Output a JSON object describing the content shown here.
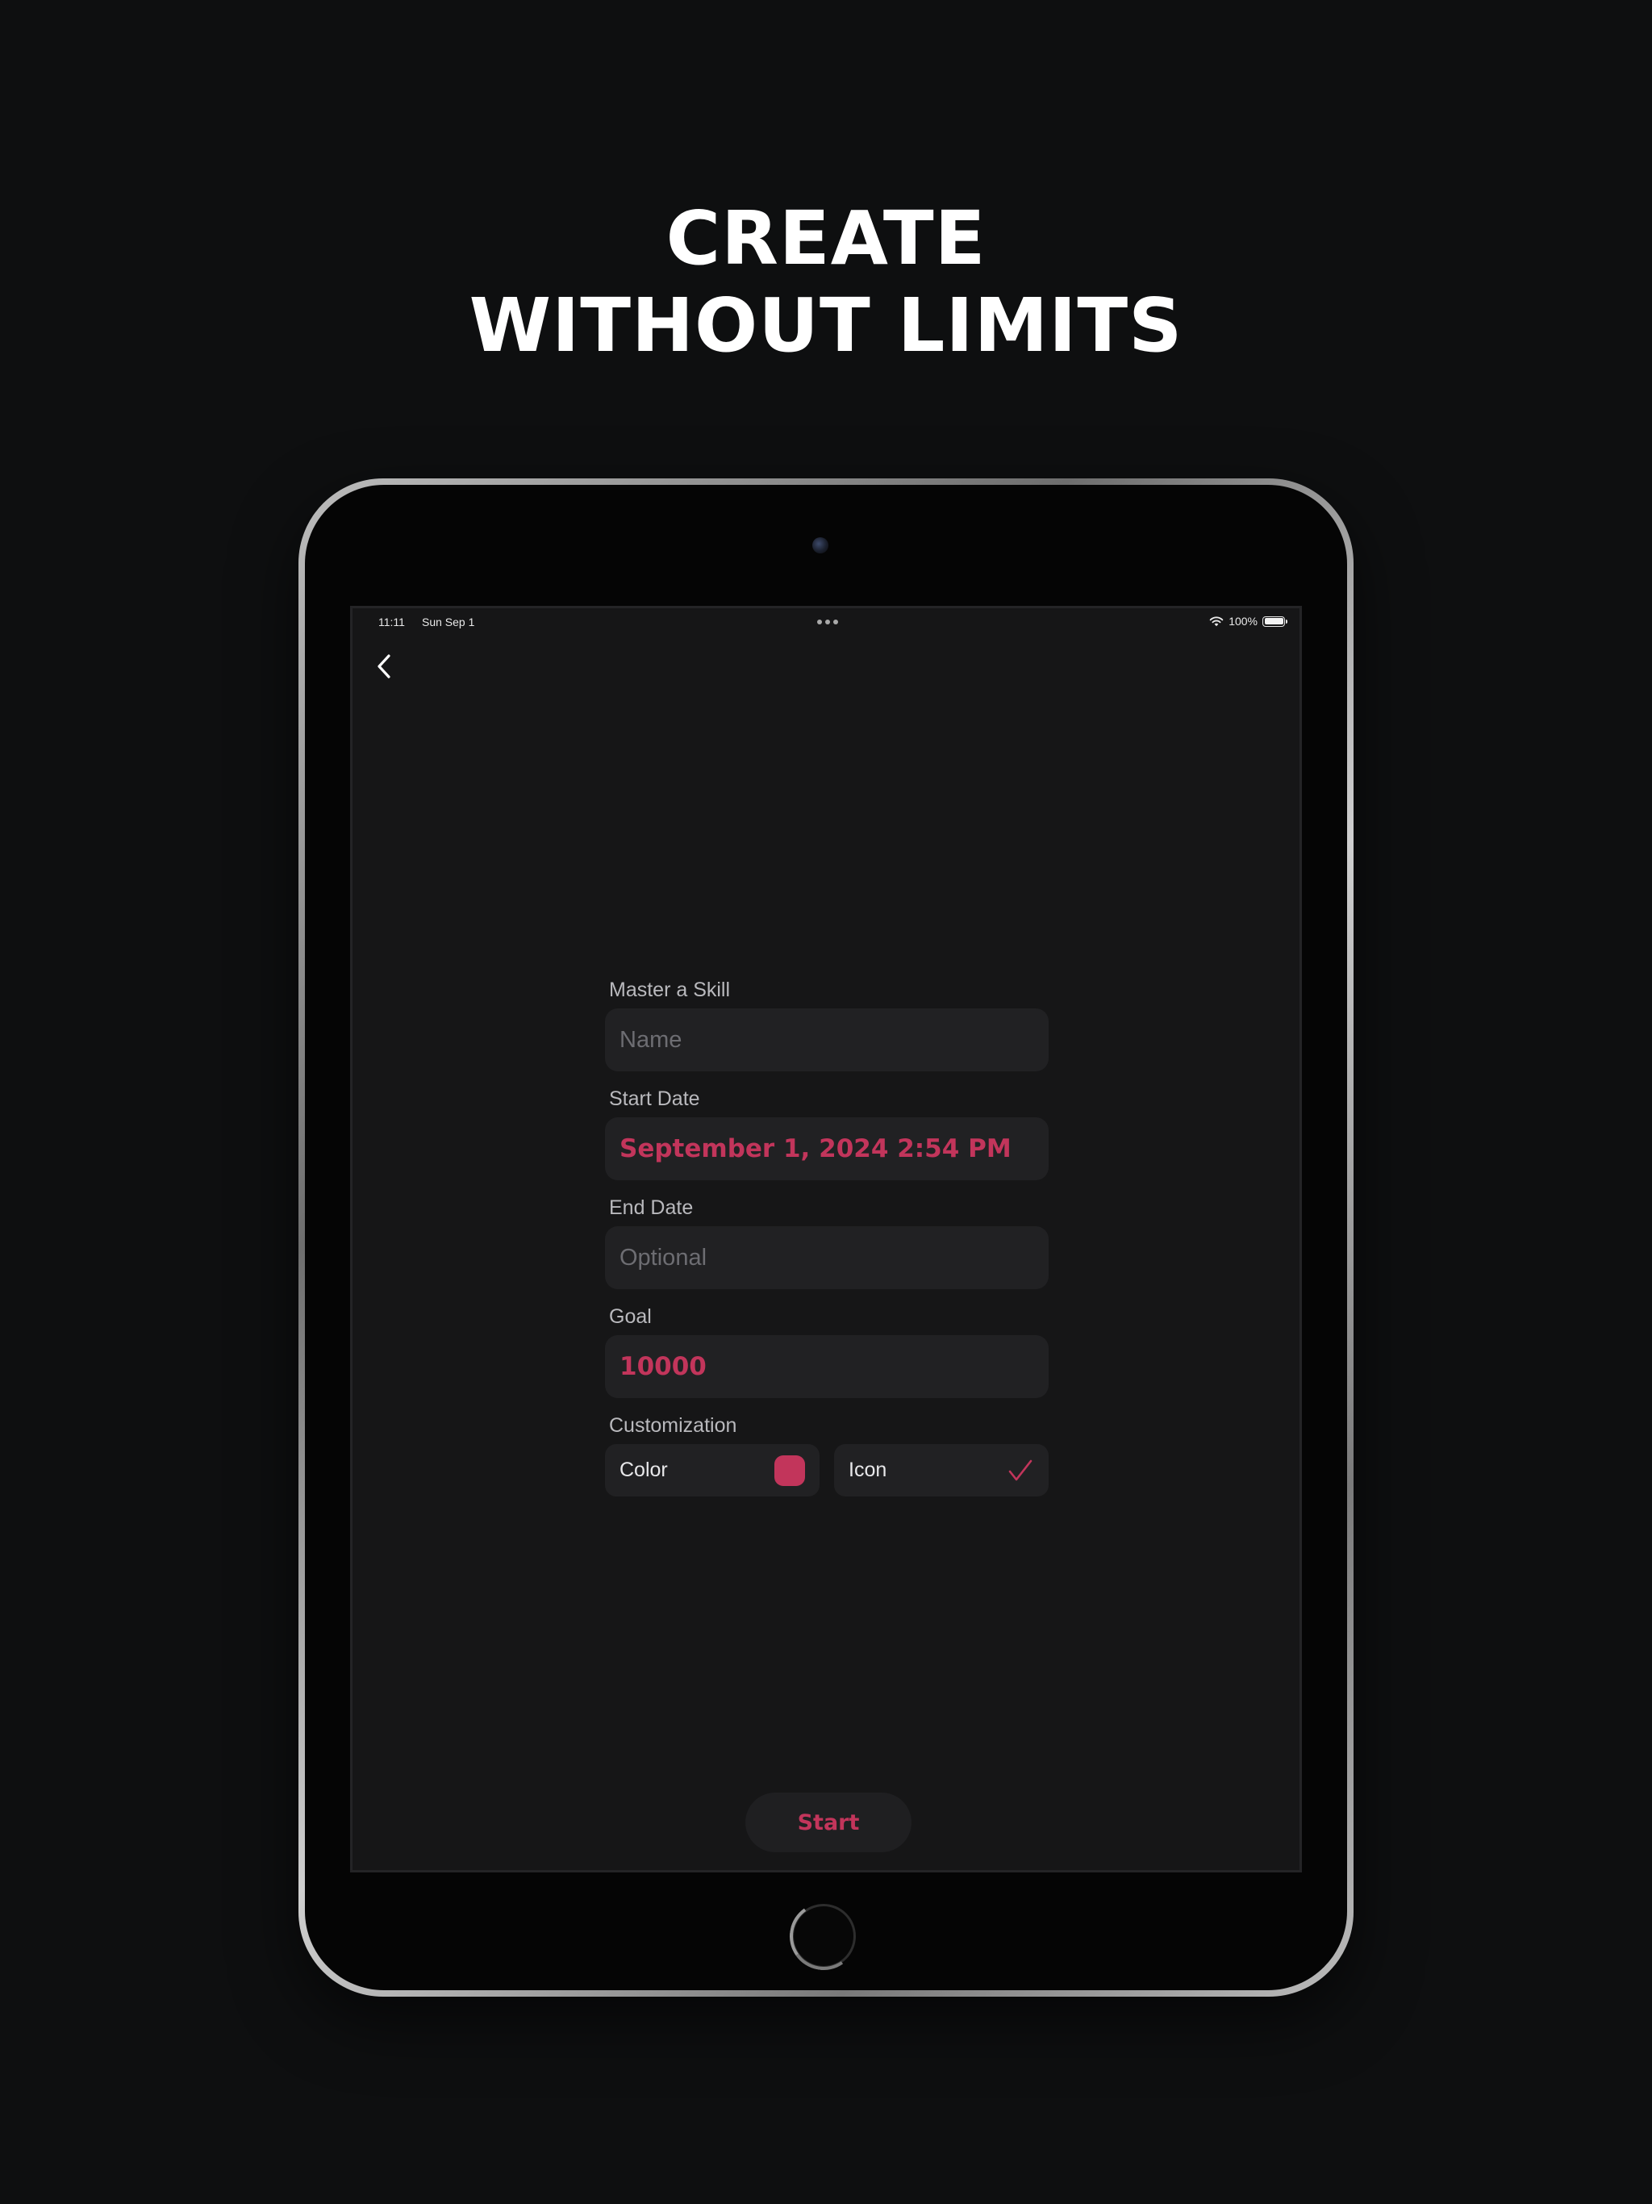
{
  "headline": {
    "line1": "CREATE",
    "line2": "WITHOUT LIMITS"
  },
  "status_bar": {
    "time": "11:11",
    "date": "Sun Sep 1",
    "battery_text": "100%",
    "battery_level": 1.0
  },
  "form": {
    "name": {
      "label": "Master a Skill",
      "placeholder": "Name",
      "value": ""
    },
    "start_date": {
      "label": "Start Date",
      "value": "September 1, 2024 2:54 PM"
    },
    "end_date": {
      "label": "End Date",
      "placeholder": "Optional",
      "value": ""
    },
    "goal": {
      "label": "Goal",
      "value": "10000"
    },
    "customization": {
      "label": "Customization",
      "color_label": "Color",
      "icon_label": "Icon",
      "selected_color": "#c2355b"
    }
  },
  "start_button": {
    "label": "Start"
  },
  "icons": {
    "back": "chevron-left-icon",
    "wifi": "wifi-icon",
    "battery": "battery-icon",
    "icon_choice": "checkmark-icon"
  },
  "colors": {
    "accent": "#c2355b",
    "background": "#0e0f10",
    "screen": "#161617",
    "field": "#212123"
  }
}
